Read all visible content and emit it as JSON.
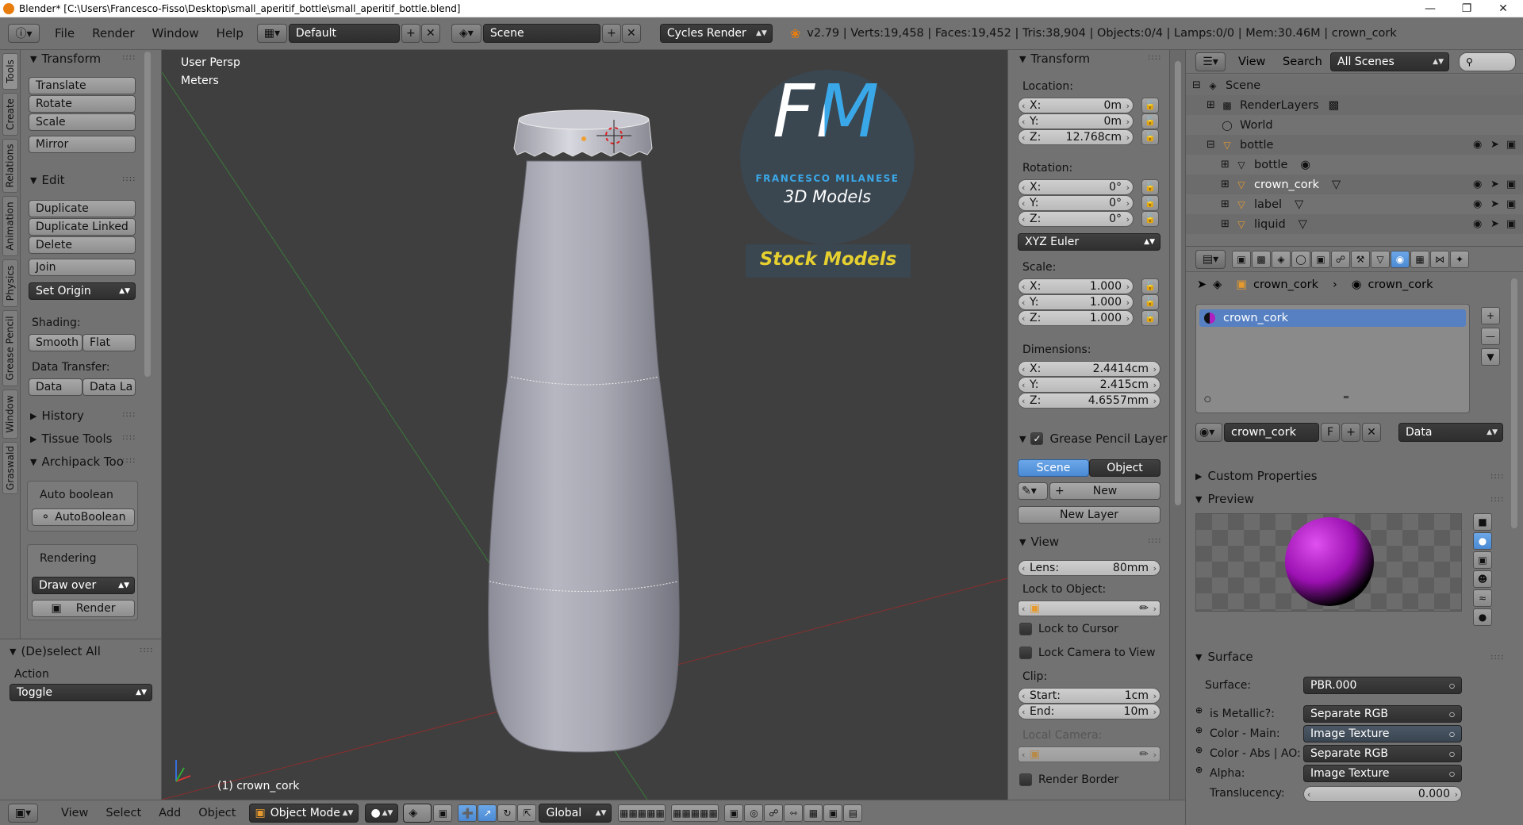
{
  "window": {
    "title": "Blender* [C:\\Users\\Francesco-Fisso\\Desktop\\small_aperitif_bottle\\small_aperitif_bottle.blend]"
  },
  "topbar": {
    "menus": [
      "File",
      "Render",
      "Window",
      "Help"
    ],
    "screen_layout": "Default",
    "scene": "Scene",
    "render_engine": "Cycles Render",
    "stats": "v2.79 | Verts:19,458 | Faces:19,452 | Tris:38,904 | Objects:0/4 | Lamps:0/0 | Mem:30.46M | crown_cork"
  },
  "vertical_tabs": [
    "Tools",
    "Create",
    "Relations",
    "Animation",
    "Physics",
    "Grease Pencil",
    "Window",
    "Graswald"
  ],
  "toolshelf": {
    "transform": {
      "title": "Transform",
      "buttons": [
        "Translate",
        "Rotate",
        "Scale",
        "Mirror"
      ]
    },
    "edit": {
      "title": "Edit",
      "buttons": [
        "Duplicate",
        "Duplicate Linked",
        "Delete",
        "Join"
      ],
      "set_origin": "Set Origin"
    },
    "shading": {
      "label": "Shading:",
      "smooth": "Smooth",
      "flat": "Flat"
    },
    "data_transfer": {
      "label": "Data Transfer:",
      "data": "Data",
      "data_layout": "Data La"
    },
    "history": "History",
    "tissue": "Tissue Tools",
    "archipack": "Archipack Too",
    "auto_boolean_label": "Auto boolean",
    "auto_boolean_btn": "AutoBoolean",
    "rendering_label": "Rendering",
    "draw_over": "Draw over",
    "render_btn": "Render"
  },
  "operator": {
    "title": "(De)select All",
    "action_label": "Action",
    "action_value": "Toggle"
  },
  "viewport": {
    "view_name": "User Persp",
    "units": "Meters",
    "object_label": "(1) crown_cork",
    "logo": {
      "letters": "FM",
      "name": "FRANCESCO MILANESE",
      "tagline": "3D Models",
      "banner": "Stock Models"
    }
  },
  "npanel": {
    "transform_title": "Transform",
    "location_label": "Location:",
    "location": [
      {
        "axis": "X:",
        "value": "0m"
      },
      {
        "axis": "Y:",
        "value": "0m"
      },
      {
        "axis": "Z:",
        "value": "12.768cm"
      }
    ],
    "rotation_label": "Rotation:",
    "rotation": [
      {
        "axis": "X:",
        "value": "0°"
      },
      {
        "axis": "Y:",
        "value": "0°"
      },
      {
        "axis": "Z:",
        "value": "0°"
      }
    ],
    "rotation_mode": "XYZ Euler",
    "scale_label": "Scale:",
    "scale": [
      {
        "axis": "X:",
        "value": "1.000"
      },
      {
        "axis": "Y:",
        "value": "1.000"
      },
      {
        "axis": "Z:",
        "value": "1.000"
      }
    ],
    "dimensions_label": "Dimensions:",
    "dimensions": [
      {
        "axis": "X:",
        "value": "2.4414cm"
      },
      {
        "axis": "Y:",
        "value": "2.415cm"
      },
      {
        "axis": "Z:",
        "value": "4.6557mm"
      }
    ],
    "grease_title": "Grease Pencil Layer",
    "grease_scene": "Scene",
    "grease_object": "Object",
    "grease_new": "New",
    "grease_new_layer": "New Layer",
    "view_title": "View",
    "lens_label": "Lens:",
    "lens_value": "80mm",
    "lock_to_object": "Lock to Object:",
    "lock_to_cursor": "Lock to Cursor",
    "lock_camera": "Lock Camera to View",
    "clip_label": "Clip:",
    "clip_start_label": "Start:",
    "clip_start": "1cm",
    "clip_end_label": "End:",
    "clip_end": "10m",
    "local_camera": "Local Camera:",
    "render_border": "Render Border"
  },
  "outliner": {
    "view_menu": "View",
    "search_menu": "Search",
    "filter": "All Scenes",
    "items": [
      {
        "label": "Scene",
        "indent": 0
      },
      {
        "label": "RenderLayers",
        "indent": 1
      },
      {
        "label": "World",
        "indent": 1
      },
      {
        "label": "bottle",
        "indent": 1
      },
      {
        "label": "bottle",
        "indent": 2
      },
      {
        "label": "crown_cork",
        "indent": 2
      },
      {
        "label": "label",
        "indent": 2
      },
      {
        "label": "liquid",
        "indent": 2
      }
    ]
  },
  "properties": {
    "breadcrumb_object": "crown_cork",
    "breadcrumb_material": "crown_cork",
    "material_slot": "crown_cork",
    "material_name": "crown_cork",
    "fake_user": "F",
    "link": "Data",
    "custom_props": "Custom Properties",
    "preview": "Preview",
    "surface_title": "Surface",
    "surface_rows": [
      {
        "label": "Surface:",
        "value": "PBR.000"
      },
      {
        "label": "is Metallic?:",
        "value": "Separate RGB"
      },
      {
        "label": "Color - Main:",
        "value": "Image Texture"
      },
      {
        "label": "Color - Abs | AO:",
        "value": "Separate RGB"
      },
      {
        "label": "Alpha:",
        "value": "Image Texture"
      }
    ],
    "translucency_label": "Translucency:",
    "translucency_value": "0.000"
  },
  "bottombar": {
    "view": "View",
    "select": "Select",
    "add": "Add",
    "object": "Object",
    "mode": "Object Mode",
    "orientation": "Global"
  }
}
